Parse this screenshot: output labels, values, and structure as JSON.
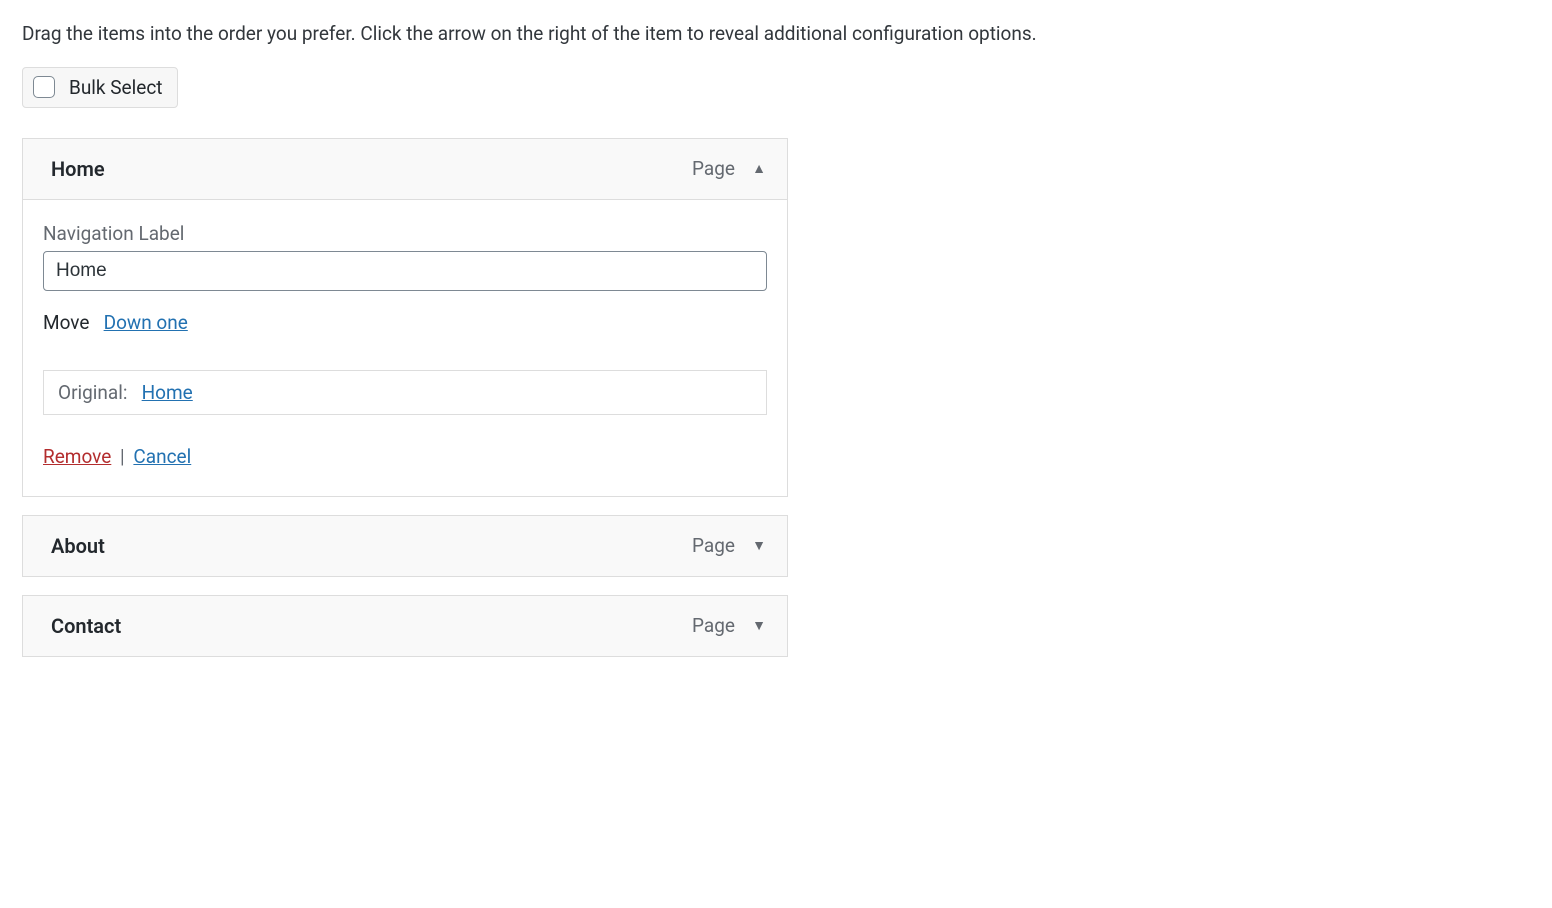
{
  "instructions": "Drag the items into the order you prefer. Click the arrow on the right of the item to reveal additional configuration options.",
  "bulkSelect": {
    "label": "Bulk Select"
  },
  "items": [
    {
      "title": "Home",
      "type": "Page",
      "expanded": true,
      "navLabelTitle": "Navigation Label",
      "navLabelValue": "Home",
      "moveLabel": "Move",
      "moveDown": "Down one",
      "originalPrefix": "Original:",
      "originalLink": "Home",
      "remove": "Remove",
      "cancel": "Cancel"
    },
    {
      "title": "About",
      "type": "Page",
      "expanded": false
    },
    {
      "title": "Contact",
      "type": "Page",
      "expanded": false
    }
  ]
}
